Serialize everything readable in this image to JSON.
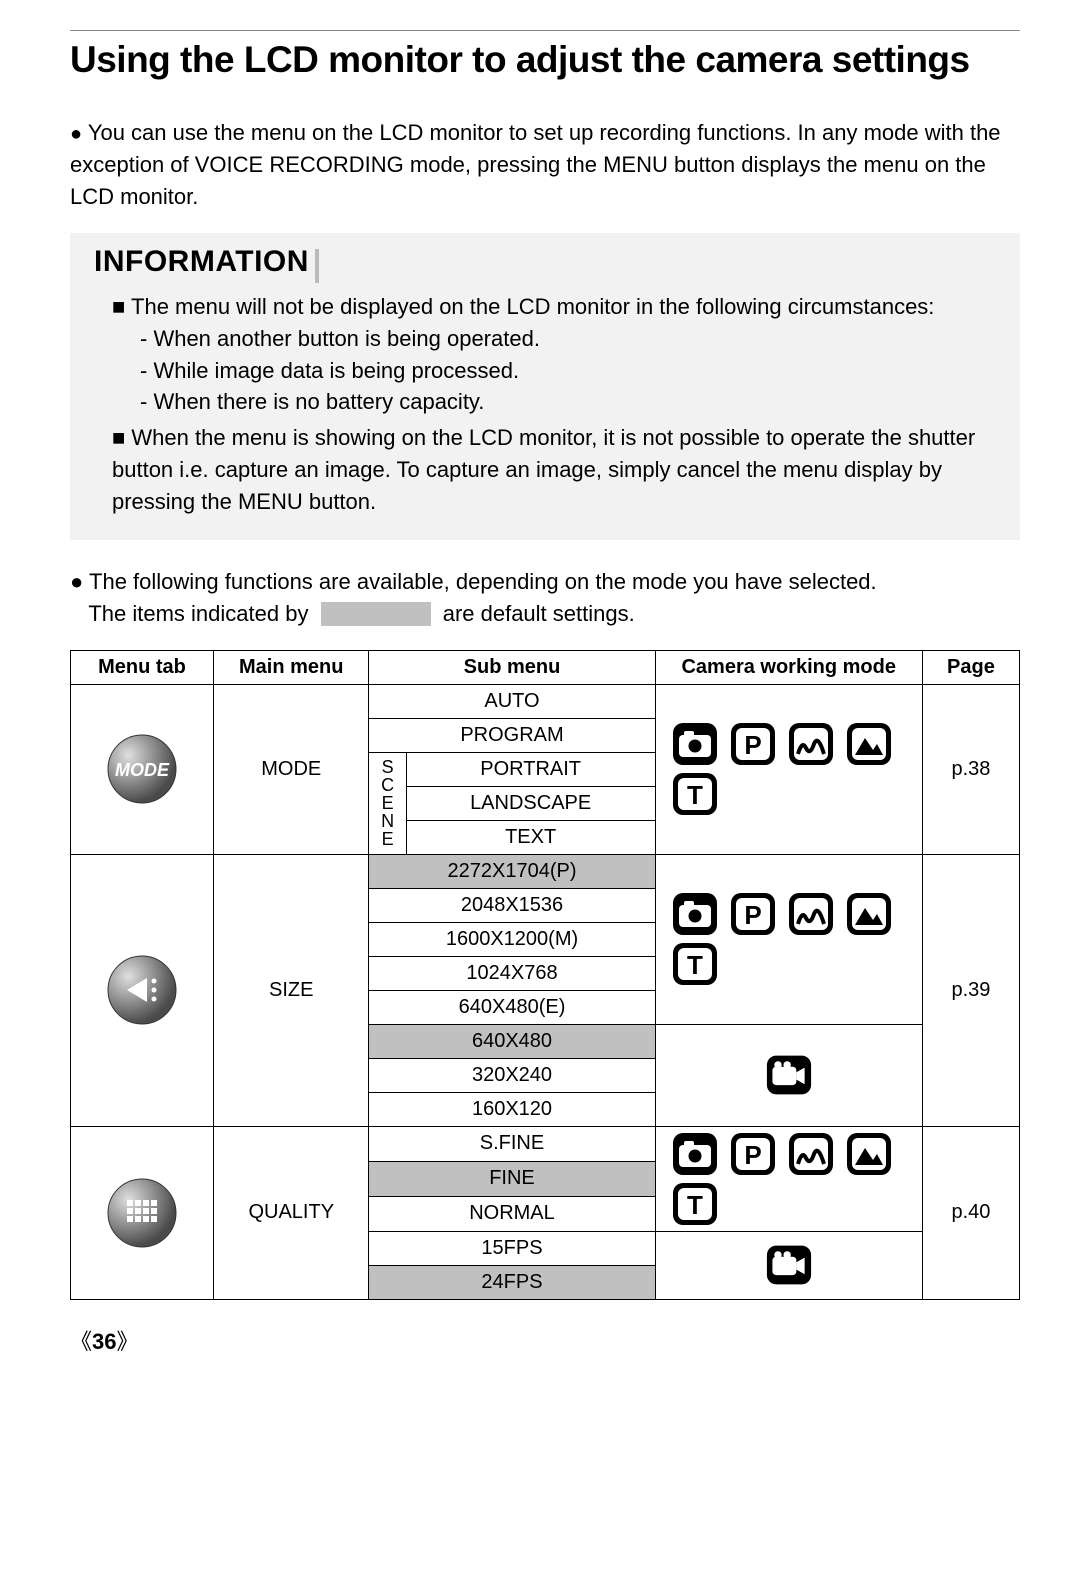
{
  "title": "Using the LCD monitor to adjust the camera settings",
  "intro_bullet": "You can use the menu on the LCD monitor to set up recording functions. In any mode with the exception of VOICE RECORDING mode, pressing the MENU button displays the menu on the LCD monitor.",
  "info": {
    "heading": "INFORMATION",
    "item1_lead": "The menu will not be displayed on the LCD monitor in the following circumstances:",
    "item1_sub1": "- When another button is being operated.",
    "item1_sub2": "- While image data is being processed.",
    "item1_sub3": "- When there is no battery capacity.",
    "item2": "When the menu is showing on the LCD monitor, it is not possible to operate the shutter button i.e. capture an image. To capture an image, simply cancel the menu display by pressing the MENU button."
  },
  "defaults": {
    "lead": "The following functions are available, depending on the mode you have selected.",
    "pre": "The items indicated by",
    "post": "are default settings."
  },
  "table": {
    "headers": {
      "menu_tab": "Menu tab",
      "main_menu": "Main menu",
      "sub_menu": "Sub menu",
      "camera_mode": "Camera working mode",
      "page": "Page"
    },
    "scene_label": "SCENE",
    "sections": [
      {
        "tab_icon": "mode",
        "tab_icon_label": "MODE",
        "main": "MODE",
        "page": "p.38",
        "modes": [
          "camera",
          "P",
          "scene",
          "mountain",
          "T"
        ],
        "rows": [
          {
            "sub": "AUTO",
            "scene": false
          },
          {
            "sub": "PROGRAM",
            "scene": false
          },
          {
            "sub": "PORTRAIT",
            "scene": true
          },
          {
            "sub": "LANDSCAPE",
            "scene": true
          },
          {
            "sub": "TEXT",
            "scene": true
          }
        ]
      },
      {
        "tab_icon": "size",
        "main": "SIZE",
        "page": "p.39",
        "mode_groups": [
          {
            "modes": [
              "camera",
              "P",
              "scene",
              "mountain",
              "T"
            ],
            "row_span": 5
          },
          {
            "modes": [
              "movie"
            ],
            "row_span": 3
          }
        ],
        "rows": [
          {
            "sub": "2272X1704(P)",
            "default": true
          },
          {
            "sub": "2048X1536"
          },
          {
            "sub": "1600X1200(M)"
          },
          {
            "sub": "1024X768"
          },
          {
            "sub": "640X480(E)"
          },
          {
            "sub": "640X480",
            "default": true
          },
          {
            "sub": "320X240"
          },
          {
            "sub": "160X120"
          }
        ]
      },
      {
        "tab_icon": "quality",
        "main": "QUALITY",
        "page": "p.40",
        "mode_groups": [
          {
            "modes": [
              "camera",
              "P",
              "scene",
              "mountain",
              "T"
            ],
            "row_span": 3
          },
          {
            "modes": [
              "movie"
            ],
            "row_span": 2
          }
        ],
        "rows": [
          {
            "sub": "S.FINE"
          },
          {
            "sub": "FINE",
            "default": true
          },
          {
            "sub": "NORMAL"
          },
          {
            "sub": "15FPS"
          },
          {
            "sub": "24FPS",
            "default": true
          }
        ]
      }
    ]
  },
  "page_number": "36"
}
